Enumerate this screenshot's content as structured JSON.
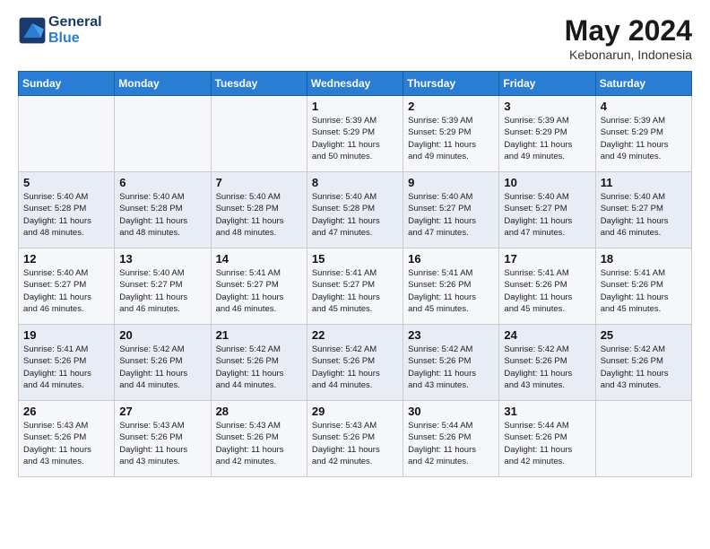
{
  "header": {
    "logo_line1": "General",
    "logo_line2": "Blue",
    "month_title": "May 2024",
    "location": "Kebonarun, Indonesia"
  },
  "weekdays": [
    "Sunday",
    "Monday",
    "Tuesday",
    "Wednesday",
    "Thursday",
    "Friday",
    "Saturday"
  ],
  "weeks": [
    [
      {
        "day": "",
        "info": ""
      },
      {
        "day": "",
        "info": ""
      },
      {
        "day": "",
        "info": ""
      },
      {
        "day": "1",
        "info": "Sunrise: 5:39 AM\nSunset: 5:29 PM\nDaylight: 11 hours\nand 50 minutes."
      },
      {
        "day": "2",
        "info": "Sunrise: 5:39 AM\nSunset: 5:29 PM\nDaylight: 11 hours\nand 49 minutes."
      },
      {
        "day": "3",
        "info": "Sunrise: 5:39 AM\nSunset: 5:29 PM\nDaylight: 11 hours\nand 49 minutes."
      },
      {
        "day": "4",
        "info": "Sunrise: 5:39 AM\nSunset: 5:29 PM\nDaylight: 11 hours\nand 49 minutes."
      }
    ],
    [
      {
        "day": "5",
        "info": "Sunrise: 5:40 AM\nSunset: 5:28 PM\nDaylight: 11 hours\nand 48 minutes."
      },
      {
        "day": "6",
        "info": "Sunrise: 5:40 AM\nSunset: 5:28 PM\nDaylight: 11 hours\nand 48 minutes."
      },
      {
        "day": "7",
        "info": "Sunrise: 5:40 AM\nSunset: 5:28 PM\nDaylight: 11 hours\nand 48 minutes."
      },
      {
        "day": "8",
        "info": "Sunrise: 5:40 AM\nSunset: 5:28 PM\nDaylight: 11 hours\nand 47 minutes."
      },
      {
        "day": "9",
        "info": "Sunrise: 5:40 AM\nSunset: 5:27 PM\nDaylight: 11 hours\nand 47 minutes."
      },
      {
        "day": "10",
        "info": "Sunrise: 5:40 AM\nSunset: 5:27 PM\nDaylight: 11 hours\nand 47 minutes."
      },
      {
        "day": "11",
        "info": "Sunrise: 5:40 AM\nSunset: 5:27 PM\nDaylight: 11 hours\nand 46 minutes."
      }
    ],
    [
      {
        "day": "12",
        "info": "Sunrise: 5:40 AM\nSunset: 5:27 PM\nDaylight: 11 hours\nand 46 minutes."
      },
      {
        "day": "13",
        "info": "Sunrise: 5:40 AM\nSunset: 5:27 PM\nDaylight: 11 hours\nand 46 minutes."
      },
      {
        "day": "14",
        "info": "Sunrise: 5:41 AM\nSunset: 5:27 PM\nDaylight: 11 hours\nand 46 minutes."
      },
      {
        "day": "15",
        "info": "Sunrise: 5:41 AM\nSunset: 5:27 PM\nDaylight: 11 hours\nand 45 minutes."
      },
      {
        "day": "16",
        "info": "Sunrise: 5:41 AM\nSunset: 5:26 PM\nDaylight: 11 hours\nand 45 minutes."
      },
      {
        "day": "17",
        "info": "Sunrise: 5:41 AM\nSunset: 5:26 PM\nDaylight: 11 hours\nand 45 minutes."
      },
      {
        "day": "18",
        "info": "Sunrise: 5:41 AM\nSunset: 5:26 PM\nDaylight: 11 hours\nand 45 minutes."
      }
    ],
    [
      {
        "day": "19",
        "info": "Sunrise: 5:41 AM\nSunset: 5:26 PM\nDaylight: 11 hours\nand 44 minutes."
      },
      {
        "day": "20",
        "info": "Sunrise: 5:42 AM\nSunset: 5:26 PM\nDaylight: 11 hours\nand 44 minutes."
      },
      {
        "day": "21",
        "info": "Sunrise: 5:42 AM\nSunset: 5:26 PM\nDaylight: 11 hours\nand 44 minutes."
      },
      {
        "day": "22",
        "info": "Sunrise: 5:42 AM\nSunset: 5:26 PM\nDaylight: 11 hours\nand 44 minutes."
      },
      {
        "day": "23",
        "info": "Sunrise: 5:42 AM\nSunset: 5:26 PM\nDaylight: 11 hours\nand 43 minutes."
      },
      {
        "day": "24",
        "info": "Sunrise: 5:42 AM\nSunset: 5:26 PM\nDaylight: 11 hours\nand 43 minutes."
      },
      {
        "day": "25",
        "info": "Sunrise: 5:42 AM\nSunset: 5:26 PM\nDaylight: 11 hours\nand 43 minutes."
      }
    ],
    [
      {
        "day": "26",
        "info": "Sunrise: 5:43 AM\nSunset: 5:26 PM\nDaylight: 11 hours\nand 43 minutes."
      },
      {
        "day": "27",
        "info": "Sunrise: 5:43 AM\nSunset: 5:26 PM\nDaylight: 11 hours\nand 43 minutes."
      },
      {
        "day": "28",
        "info": "Sunrise: 5:43 AM\nSunset: 5:26 PM\nDaylight: 11 hours\nand 42 minutes."
      },
      {
        "day": "29",
        "info": "Sunrise: 5:43 AM\nSunset: 5:26 PM\nDaylight: 11 hours\nand 42 minutes."
      },
      {
        "day": "30",
        "info": "Sunrise: 5:44 AM\nSunset: 5:26 PM\nDaylight: 11 hours\nand 42 minutes."
      },
      {
        "day": "31",
        "info": "Sunrise: 5:44 AM\nSunset: 5:26 PM\nDaylight: 11 hours\nand 42 minutes."
      },
      {
        "day": "",
        "info": ""
      }
    ]
  ]
}
